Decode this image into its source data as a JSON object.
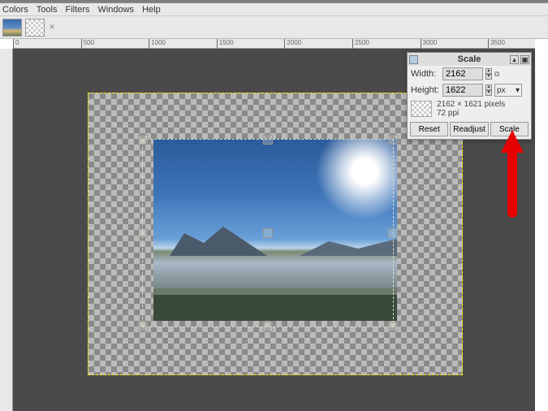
{
  "menu": {
    "colors": "Colors",
    "tools": "Tools",
    "filters": "Filters",
    "windows": "Windows",
    "help": "Help"
  },
  "ruler": {
    "t0": "0",
    "t1": "500",
    "t2": "1000",
    "t3": "1500",
    "t4": "2000",
    "t5": "2500",
    "t6": "3000",
    "t7": "3500"
  },
  "dialog": {
    "title": "Scale",
    "width_label": "Width:",
    "height_label": "Height:",
    "width_value": "2162",
    "height_value": "1622",
    "unit": "px",
    "info_dims": "2162 × 1621 pixels",
    "info_ppi": "72 ppi",
    "reset": "Reset",
    "readjust": "Readjust",
    "scale": "Scale"
  }
}
